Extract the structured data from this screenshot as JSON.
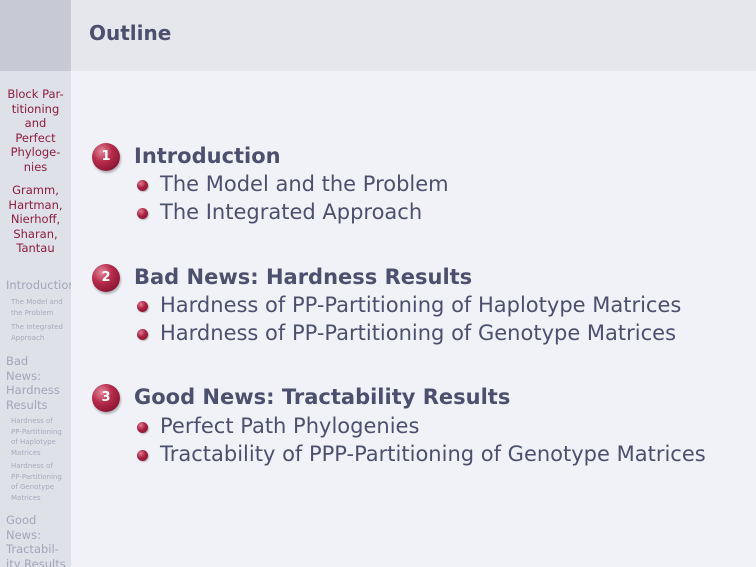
{
  "frame": {
    "title": "Outline"
  },
  "sidebar": {
    "title_lines": [
      "Block Par-",
      "titioning",
      "and",
      "Perfect",
      "Phyloge-",
      "nies"
    ],
    "author_lines": [
      "Gramm,",
      "Hartman,",
      "Nierhoff,",
      "Sharan,",
      "Tantau"
    ],
    "sections": [
      {
        "lines": [
          "Introduction"
        ],
        "subsections": [
          {
            "lines": [
              "The Model and",
              "the Problem"
            ]
          },
          {
            "lines": [
              "The Integrated",
              "Approach"
            ]
          }
        ]
      },
      {
        "lines": [
          "Bad",
          "News:",
          "Hardness",
          "Results"
        ],
        "subsections": [
          {
            "lines": [
              "Hardness of",
              "PP-Partitioning",
              "of Haplotype",
              "Matrices"
            ]
          },
          {
            "lines": [
              "Hardness of",
              "PP-Partitioning",
              "of Genotype",
              "Matrices"
            ]
          }
        ]
      },
      {
        "lines": [
          "Good",
          "News:",
          "Tractabil-",
          "ity Results"
        ],
        "subsections": []
      }
    ]
  },
  "toc": [
    {
      "number": "1",
      "title": "Introduction",
      "subsections": [
        "The Model and the Problem",
        "The Integrated Approach"
      ]
    },
    {
      "number": "2",
      "title": "Bad News: Hardness Results",
      "subsections": [
        "Hardness of PP-Partitioning of Haplotype Matrices",
        "Hardness of PP-Partitioning of Genotype Matrices"
      ]
    },
    {
      "number": "3",
      "title": "Good News: Tractability Results",
      "subsections": [
        "Perfect Path Phylogenies",
        "Tractability of PPP-Partitioning of Genotype Matrices"
      ]
    }
  ],
  "colors": {
    "title_text": "#4c506e",
    "sidebar_title": "#8c1d3d",
    "sidebar_nav": "#a2a6ba",
    "bullet": "#a8203f"
  }
}
